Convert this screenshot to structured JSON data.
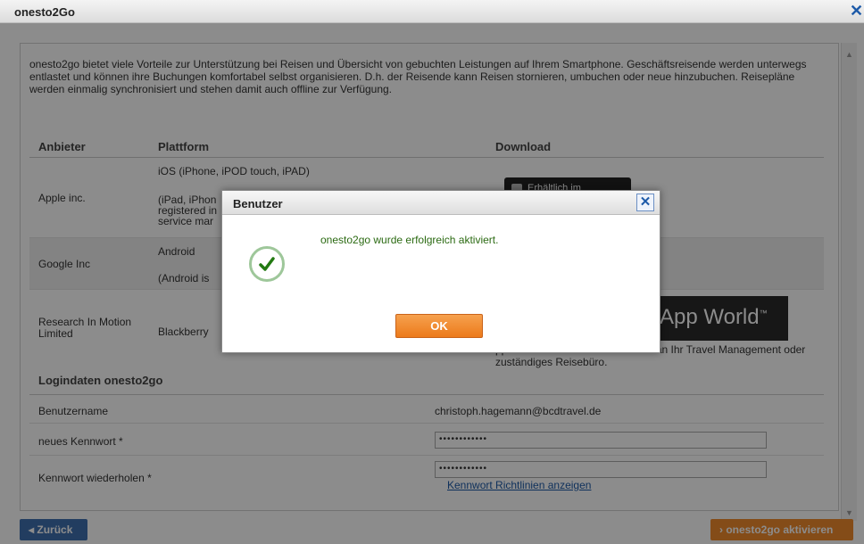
{
  "window": {
    "title": "onesto2Go",
    "close": "✕"
  },
  "intro": "onesto2go bietet viele Vorteile zur Unterstützung bei Reisen und Übersicht von gebuchten Leistungen auf Ihrem Smartphone. Geschäftsreisende werden unterwegs entlastet und können ihre Buchungen komfortabel selbst organisieren. D.h. der Reisende kann Reisen stornieren, umbuchen oder neue hinzubuchen. Reisepläne werden einmalig synchronisiert und stehen damit auch offline zur Verfügung.",
  "table": {
    "headers": {
      "provider": "Anbieter",
      "platform": "Plattform",
      "download": "Download"
    },
    "apple": {
      "provider": "Apple inc.",
      "platform": "iOS (iPhone, iPOD touch, iPAD)",
      "note": "(iPad, iPhon",
      "note2": "registered in",
      "note3": "service mar",
      "download_label": "Erhältlich im"
    },
    "google": {
      "provider": "Google Inc",
      "platform": "Android",
      "note": "(Android is"
    },
    "rim": {
      "provider": "Research In Motion Limited",
      "platform": "Blackberry",
      "appworld": "App World",
      "tm": "™",
      "note": "pp World™ wenden Sie sich bitte an Ihr Travel Management oder zuständiges Reisebüro."
    }
  },
  "login": {
    "title": "Logindaten onesto2go",
    "username_label": "Benutzername",
    "username_value": "christoph.hagemann@bcdtravel.de",
    "new_pw_label": "neues Kennwort *",
    "new_pw_value": "••••••••••••",
    "repeat_pw_label": "Kennwort wiederholen *",
    "repeat_pw_value": "••••••••••••",
    "pw_rules_link": "Kennwort Richtlinien anzeigen"
  },
  "footer": {
    "back": "◂ Zurück",
    "activate": "› onesto2go aktivieren"
  },
  "dialog": {
    "title": "Benutzer",
    "close": "✕",
    "message": "onesto2go wurde erfolgreich aktiviert.",
    "ok": "OK"
  },
  "colors": {
    "accent_blue": "#1d5aa8",
    "orange": "#f08a2c",
    "success_green": "#2b6a12"
  }
}
